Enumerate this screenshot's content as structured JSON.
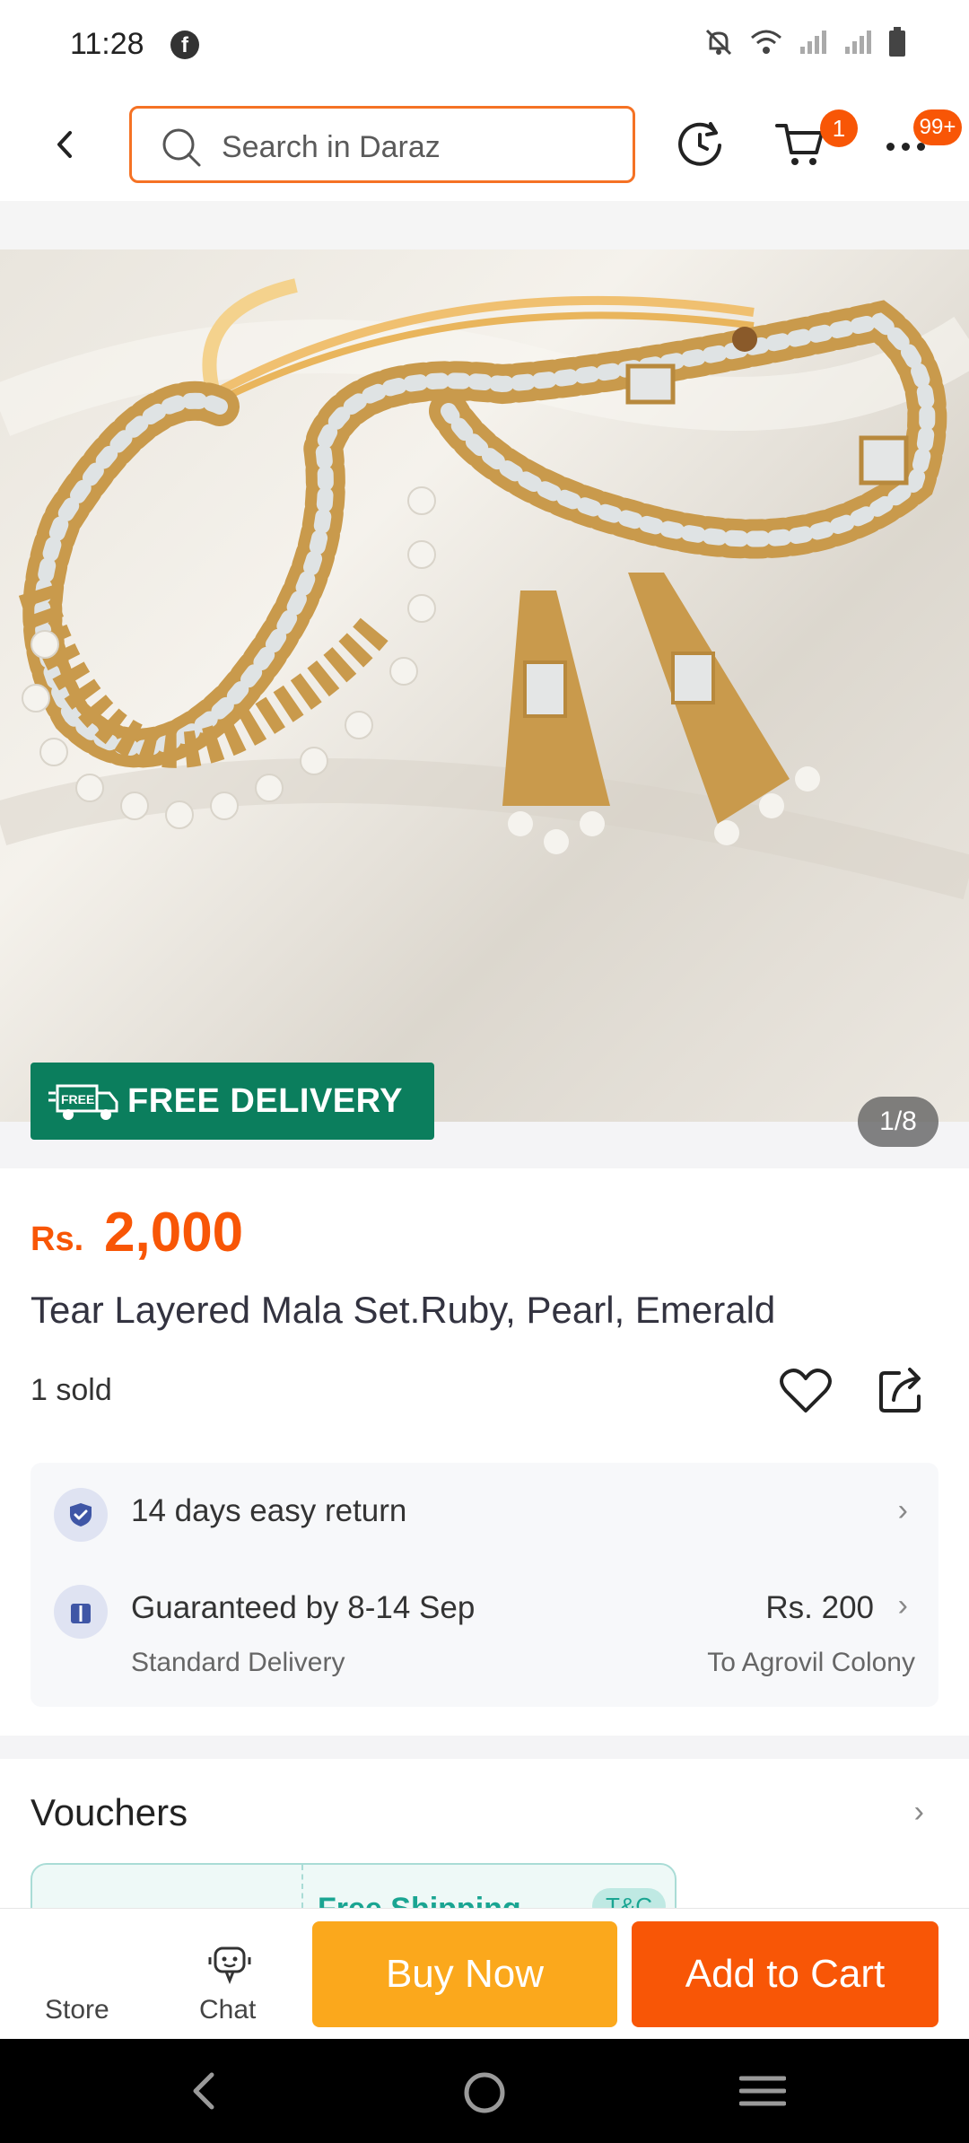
{
  "status_bar": {
    "time": "11:28"
  },
  "header": {
    "search_placeholder": "Search in Daraz",
    "cart_badge": "1",
    "more_badge": "99+"
  },
  "gallery": {
    "free_delivery_label": "FREE DELIVERY",
    "free_delivery_icon_text": "FREE",
    "image_counter": "1/8"
  },
  "product": {
    "currency": "Rs.",
    "price": "2,000",
    "title": "Tear Layered Mala Set.Ruby, Pearl, Emerald",
    "sold": "1 sold"
  },
  "services": {
    "return": "14 days easy return",
    "delivery_guarantee": "Guaranteed by 8-14 Sep",
    "delivery_type": "Standard Delivery",
    "delivery_fee": "Rs. 200",
    "delivery_location": "To Agrovil Colony"
  },
  "vouchers": {
    "title": "Vouchers",
    "card_text": "Free Shipping",
    "card_badge": "T&C"
  },
  "bottom_bar": {
    "store_label": "Store",
    "chat_label": "Chat",
    "buy_now_label": "Buy Now",
    "add_to_cart_label": "Add to Cart"
  },
  "colors": {
    "accent_orange": "#f85606",
    "buy_now_yellow": "#fba81c",
    "free_delivery_green": "#0b7e5d"
  }
}
